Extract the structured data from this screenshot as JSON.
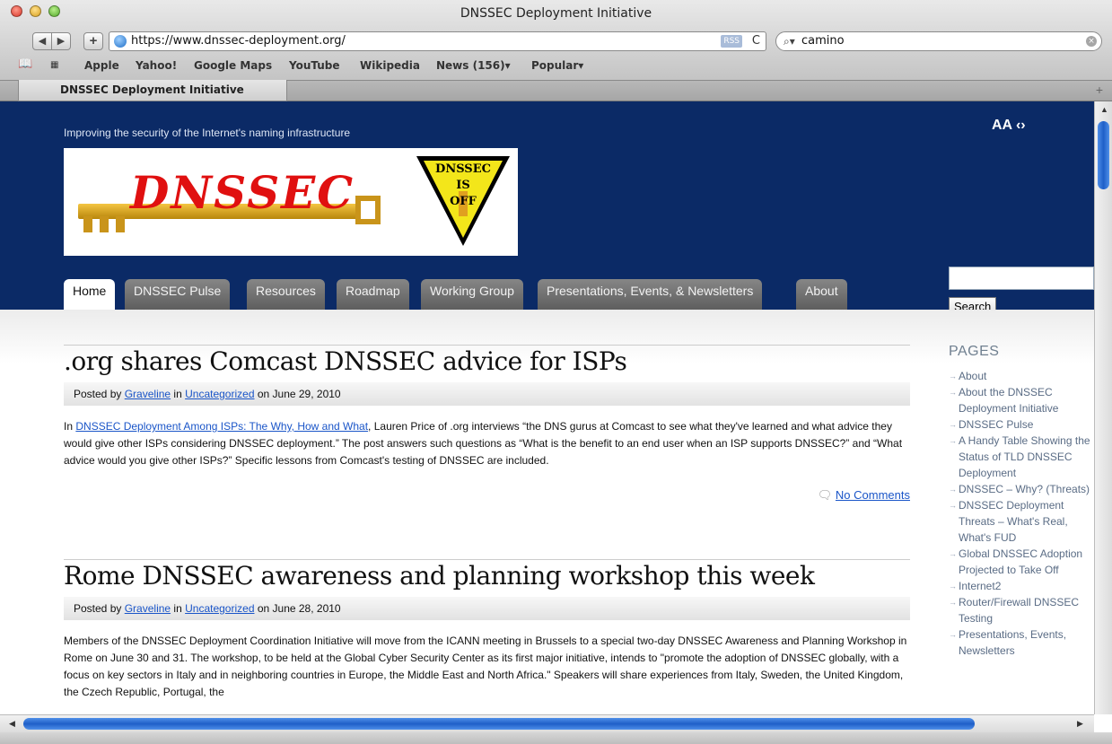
{
  "browser": {
    "window_title": "DNSSEC Deployment Initiative",
    "url": "https://www.dnssec-deployment.org/",
    "rss_label": "RSS",
    "search_value": "camino",
    "back_glyph": "◀",
    "forward_glyph": "▶",
    "add_glyph": "+",
    "reload_glyph": "C",
    "bookmarks": [
      "Apple",
      "Yahoo!",
      "Google Maps",
      "YouTube",
      "Wikipedia",
      "News (156)▾",
      "Popular▾"
    ],
    "tab_title": "DNSSEC Deployment Initiative"
  },
  "site": {
    "slogan": "Improving the security of the Internet's naming infrastructure",
    "font_size_control": "AA ‹›",
    "logo_text": "DNSSEC",
    "sign_lines": [
      "DNSSEC",
      "IS",
      "OFF"
    ],
    "nav": [
      "Home",
      "DNSSEC Pulse",
      "Resources",
      "Roadmap",
      "Working Group",
      "Presentations, Events, & Newsletters",
      "About"
    ],
    "search_button": "Search"
  },
  "posts": [
    {
      "title": ".org shares Comcast DNSSEC advice for ISPs",
      "meta_posted_by": "Posted by",
      "meta_author": "Graveline",
      "meta_in": "in",
      "meta_category": "Uncategorized",
      "meta_on": "on June 29, 2010",
      "body_link": "DNSSEC Deployment Among ISPs: The Why, How and What",
      "body_text": ", Lauren Price of .org interviews “the DNS gurus at Comcast to see what they've learned and what advice they would give other ISPs considering DNSSEC deployment.” The post answers such questions as “What is the benefit to an end user when an ISP supports DNSSEC?” and “What advice would you give other ISPs?” Specific lessons from Comcast's testing of DNSSEC are included.",
      "body_prefix": "In",
      "comments": "No Comments"
    },
    {
      "title": "Rome DNSSEC awareness and planning workshop this week",
      "meta_posted_by": "Posted by",
      "meta_author": "Graveline",
      "meta_in": "in",
      "meta_category": "Uncategorized",
      "meta_on": "on June 28, 2010",
      "body_text": "Members of the DNSSEC Deployment Coordination Initiative will move from the ICANN meeting in Brussels to a special two-day DNSSEC Awareness and Planning Workshop in Rome on June 30 and 31. The workshop, to be held at the Global Cyber Security Center as its first major initiative, intends to \"promote the adoption of DNSSEC globally, with a focus on key sectors in Italy and in neighboring countries in Europe, the Middle East and North Africa.\" Speakers will share experiences from Italy, Sweden, the United Kingdom, the Czech Republic, Portugal, the"
    }
  ],
  "sidebar": {
    "heading": "PAGES",
    "items": [
      "About",
      "About the DNSSEC Deployment Initiative",
      "DNSSEC Pulse",
      "A Handy Table Showing the Status of TLD DNSSEC Deployment",
      "DNSSEC – Why? (Threats)",
      "DNSSEC Deployment Threats – What's Real, What's FUD",
      "Global DNSSEC Adoption Projected to Take Off",
      "Internet2",
      "Router/Firewall DNSSEC Testing",
      "Presentations, Events, Newsletters"
    ]
  }
}
